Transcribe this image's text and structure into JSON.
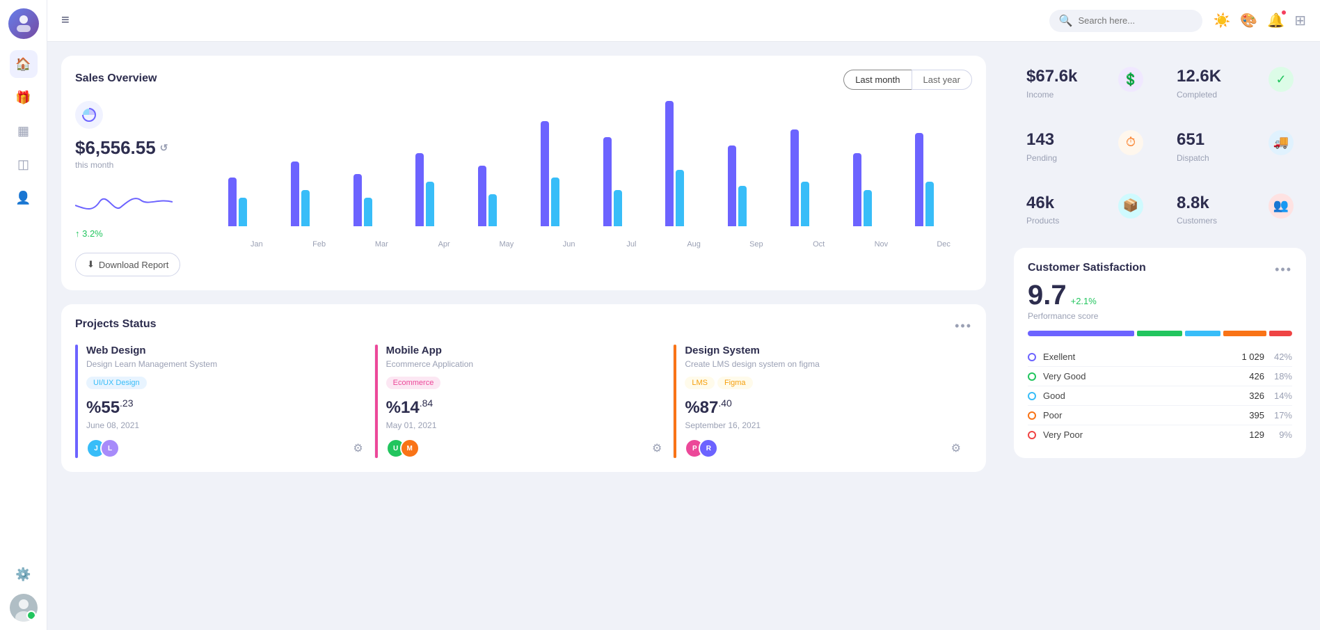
{
  "sidebar": {
    "icons": [
      "home",
      "gift",
      "grid",
      "layers",
      "user",
      "cloud"
    ],
    "active": "home"
  },
  "topbar": {
    "search_placeholder": "Search here...",
    "hamburger_label": "≡"
  },
  "sales": {
    "title": "Sales Overview",
    "time_buttons": [
      "Last month",
      "Last year"
    ],
    "amount": "$6,556.55",
    "period": "this month",
    "growth": "↑ 3.2%",
    "download_label": "Download Report",
    "chart": {
      "months": [
        "Jan",
        "Feb",
        "Mar",
        "Apr",
        "May",
        "Jun",
        "Jul",
        "Aug",
        "Sep",
        "Oct",
        "Nov",
        "Dec"
      ],
      "purple": [
        60,
        80,
        65,
        90,
        75,
        130,
        110,
        155,
        100,
        120,
        90,
        115
      ],
      "cyan": [
        35,
        45,
        35,
        55,
        40,
        60,
        45,
        70,
        50,
        55,
        45,
        55
      ]
    }
  },
  "stats": {
    "items": [
      {
        "value": "$67.6k",
        "label": "Income",
        "icon": "💲",
        "icon_class": "purple"
      },
      {
        "value": "12.6K",
        "label": "Completed",
        "icon": "✓",
        "icon_class": "green"
      },
      {
        "value": "143",
        "label": "Pending",
        "icon": "⏱",
        "icon_class": "orange"
      },
      {
        "value": "651",
        "label": "Dispatch",
        "icon": "🚚",
        "icon_class": "blue"
      },
      {
        "value": "46k",
        "label": "Products",
        "icon": "📦",
        "icon_class": "cyan"
      },
      {
        "value": "8.8k",
        "label": "Customers",
        "icon": "👥",
        "icon_class": "red"
      }
    ]
  },
  "projects": {
    "title": "Projects Status",
    "items": [
      {
        "name": "Web Design",
        "desc": "Design Learn Management System",
        "tag": "UI/UX Design",
        "tag_class": "blue",
        "percent_main": "55",
        "percent_sub": ".23",
        "date": "June 08, 2021",
        "color": "blue",
        "avatars": [
          "J",
          "L"
        ]
      },
      {
        "name": "Mobile App",
        "desc": "Ecommerce Application",
        "tag": "Ecommerce",
        "tag_class": "pink",
        "percent_main": "14",
        "percent_sub": ".84",
        "date": "May 01, 2021",
        "color": "pink",
        "avatars": [
          "U",
          "M"
        ]
      },
      {
        "name": "Design System",
        "desc": "Create LMS design system on figma",
        "tag": "LMS",
        "tag2": "Figma",
        "tag_class": "yellow",
        "tag2_class": "yellow",
        "percent_main": "87",
        "percent_sub": ".40",
        "date": "September 16, 2021",
        "color": "orange",
        "avatars": [
          "P",
          "R"
        ]
      }
    ]
  },
  "satisfaction": {
    "title": "Customer Satisfaction",
    "score": "9.7",
    "growth": "+2.1%",
    "label": "Performance score",
    "rows": [
      {
        "label": "Exellent",
        "count": "1 029",
        "pct": "42%",
        "dot": "purple"
      },
      {
        "label": "Very Good",
        "count": "426",
        "pct": "18%",
        "dot": "green"
      },
      {
        "label": "Good",
        "count": "326",
        "pct": "14%",
        "dot": "blue"
      },
      {
        "label": "Poor",
        "count": "395",
        "pct": "17%",
        "dot": "orange"
      },
      {
        "label": "Very Poor",
        "count": "129",
        "pct": "9%",
        "dot": "red"
      }
    ]
  }
}
